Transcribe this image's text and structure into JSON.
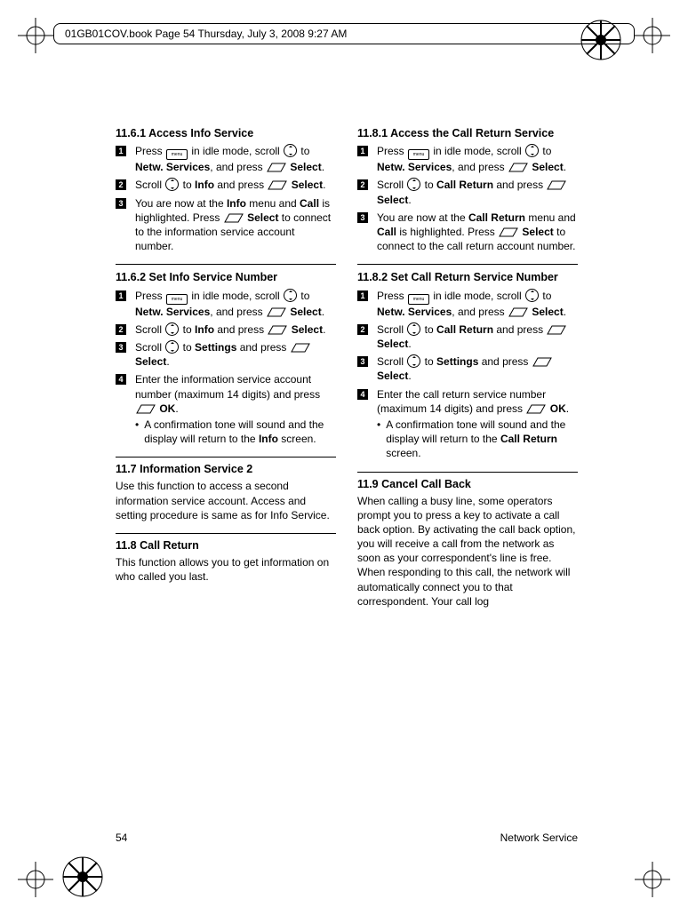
{
  "print_header": "01GB01COV.book  Page 54  Thursday, July 3, 2008  9:27 AM",
  "icons": {
    "menu_label": "menu"
  },
  "left": {
    "s1": {
      "title": "11.6.1 Access Info Service",
      "step1_a": "Press ",
      "step1_b": " in idle mode, scroll ",
      "step1_c": " to ",
      "step1_bold1": "Netw. Services",
      "step1_d": ", and press ",
      "step1_soft": "Select",
      "step1_e": ".",
      "step2_a": "Scroll ",
      "step2_b": " to ",
      "step2_bold": "Info",
      "step2_c": " and press ",
      "step2_soft": "Select",
      "step2_d": ".",
      "step3_a": "You are now at the ",
      "step3_bold1": "Info",
      "step3_b": " menu and ",
      "step3_bold2": "Call",
      "step3_c": " is highlighted. Press ",
      "step3_soft": "Select",
      "step3_d": " to connect to the information service account number."
    },
    "s2": {
      "title": "11.6.2 Set Info Service Number",
      "step1_a": "Press ",
      "step1_b": " in idle mode, scroll ",
      "step1_c": " to ",
      "step1_bold1": "Netw. Services",
      "step1_d": ", and press ",
      "step1_soft": "Select",
      "step1_e": ".",
      "step2_a": "Scroll ",
      "step2_b": " to ",
      "step2_bold": "Info",
      "step2_c": " and press ",
      "step2_soft": "Select",
      "step2_d": ".",
      "step3_a": "Scroll ",
      "step3_b": " to ",
      "step3_bold": "Settings",
      "step3_c": " and press ",
      "step3_soft": "Select",
      "step3_d": ".",
      "step4_a": "Enter the information service account number (maximum 14 digits) and press ",
      "step4_soft": "OK",
      "step4_b": ".",
      "bullet_a": "A confirmation tone will sound and the display will return to the ",
      "bullet_bold": "Info",
      "bullet_b": " screen."
    },
    "s3": {
      "title": "11.7    Information Service 2",
      "body": "Use this function to access a second information service account. Access and setting procedure is same as for Info Service."
    },
    "s4": {
      "title": "11.8    Call Return",
      "body": "This function allows you to get information on who called you last."
    }
  },
  "right": {
    "s1": {
      "title": "11.8.1 Access the Call Return Service",
      "step1_a": "Press ",
      "step1_b": " in idle mode, scroll ",
      "step1_c": " to ",
      "step1_bold1": "Netw. Services",
      "step1_d": ", and press ",
      "step1_soft": "Select",
      "step1_e": ".",
      "step2_a": "Scroll ",
      "step2_b": " to ",
      "step2_bold": "Call Return",
      "step2_c": " and press ",
      "step2_soft": "Select",
      "step2_d": ".",
      "step3_a": "You are now at the ",
      "step3_bold1": "Call Return",
      "step3_b": " menu and ",
      "step3_bold2": "Call",
      "step3_c": " is highlighted. Press ",
      "step3_soft": "Select",
      "step3_d": " to connect to the call return account number."
    },
    "s2": {
      "title": "11.8.2 Set Call Return Service Number",
      "step1_a": "Press ",
      "step1_b": " in idle mode, scroll ",
      "step1_c": " to ",
      "step1_bold1": "Netw. Services",
      "step1_d": ", and press ",
      "step1_soft": "Select",
      "step1_e": ".",
      "step2_a": "Scroll ",
      "step2_b": " to ",
      "step2_bold": "Call Return",
      "step2_c": " and press ",
      "step2_soft": "Select",
      "step2_d": ".",
      "step3_a": "Scroll ",
      "step3_b": " to ",
      "step3_bold": "Settings",
      "step3_c": " and press ",
      "step3_soft": "Select",
      "step3_d": ".",
      "step4_a": "Enter the call return service number (maximum 14 digits) and press ",
      "step4_soft": "OK",
      "step4_b": ".",
      "bullet_a": "A confirmation tone will sound and the display will return to the ",
      "bullet_bold": "Call Return",
      "bullet_b": " screen."
    },
    "s3": {
      "title": "11.9    Cancel Call Back",
      "body": "When calling a busy line, some operators prompt you to press a key to activate a call back option. By activating the call back option, you will receive a call from the network as soon as your correspondent's line is free. When responding to this call, the network will automatically connect you to that correspondent. Your call log"
    }
  },
  "footer": {
    "page": "54",
    "section": "Network Service"
  }
}
